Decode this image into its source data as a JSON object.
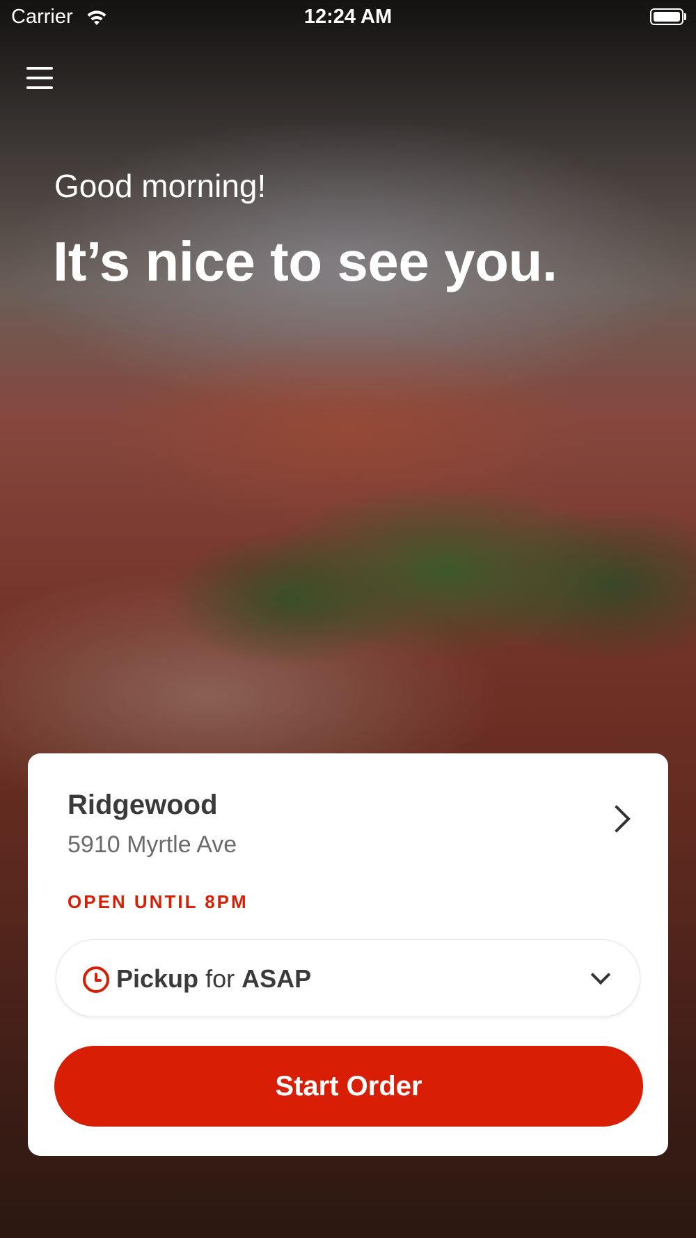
{
  "status_bar": {
    "carrier": "Carrier",
    "time": "12:24 AM",
    "icons": [
      "wifi-icon",
      "battery-icon"
    ]
  },
  "header": {
    "menu_icon": "hamburger-menu-icon"
  },
  "hero": {
    "greeting": "Good morning!",
    "headline": "It’s nice to see you."
  },
  "location_card": {
    "name": "Ridgewood",
    "address": "5910 Myrtle Ave",
    "status": "OPEN UNTIL 8PM",
    "pickup": {
      "mode": "Pickup",
      "connector": "for",
      "time": "ASAP"
    },
    "start_order_label": "Start Order"
  },
  "colors": {
    "accent": "#d81e05",
    "card_background": "#ffffff",
    "text_dark": "#3a3a3a",
    "text_muted": "#6b6b6b"
  }
}
